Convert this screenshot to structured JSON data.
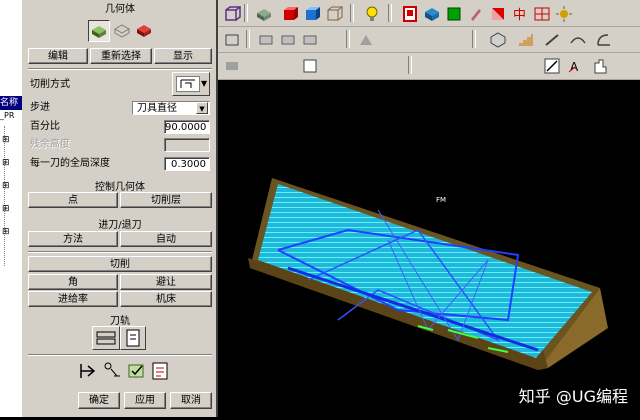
{
  "dialog": {
    "title": "几何体",
    "geom_buttons": [
      "编辑",
      "重新选择",
      "显示"
    ],
    "cut_method_label": "切削方式",
    "step_label": "步进",
    "step_value": "刀具直径",
    "percent_label": "百分比",
    "percent_value": "90.0000",
    "scallop_label": "残余高度",
    "global_depth_label": "每一刀的全局深度",
    "global_depth_value": "0.3000",
    "control_geom_title": "控制几何体",
    "point_button": "点",
    "cut_levels_button": "切削层",
    "engage_title": "进刀/退刀",
    "method_button": "方法",
    "auto_button": "自动",
    "cutting_button": "切削",
    "corner_button": "角",
    "avoid_button": "避让",
    "feedrate_button": "进给率",
    "machine_button": "机床",
    "toolpath_title": "刀轨",
    "ok_button": "确定",
    "apply_button": "应用",
    "cancel_button": "取消"
  },
  "navigator": {
    "label1": "名称",
    "label2": "_PR"
  },
  "viewport": {
    "part_label": "FM",
    "watermark": "知乎 @UG编程"
  },
  "colors": {
    "dialog_bg": "#d4d0c8",
    "toolpath_cyan": "#2ee6ff",
    "toolpath_blue": "#2040ff",
    "part_brown": "#8a6a2a"
  }
}
